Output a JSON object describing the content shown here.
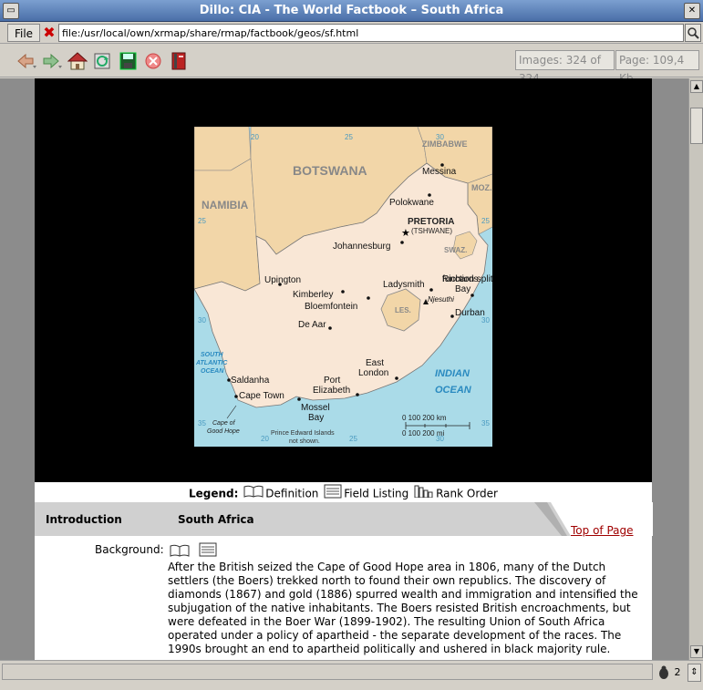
{
  "window": {
    "title": "Dillo: CIA - The World Factbook – South Africa"
  },
  "location": {
    "file_menu": "File",
    "url": "file:/usr/local/own/xrmap/share/rmap/factbook/geos/sf.html"
  },
  "toolbar": {
    "tools": [
      "back-icon",
      "forward-icon",
      "home-icon",
      "reload-icon",
      "save-icon",
      "stop-icon",
      "bookmarks-icon"
    ],
    "images_status": "Images: 324 of 324",
    "page_status": "Page: 109,4 Kb"
  },
  "map": {
    "countries": [
      "BOTSWANA",
      "NAMIBIA",
      "ZIMBABWE",
      "MOZ.",
      "SWAZ.",
      "LES."
    ],
    "capital": "PRETORIA",
    "capital_alt": "(TSHWANE)",
    "cities": [
      "Messina",
      "Polokwane",
      "Johannesburg",
      "Upington",
      "Kimberley",
      "Bloemfontein",
      "Ladysmith",
      "Richards Bay",
      "Njesuthi",
      "Durban",
      "De Aar",
      "Saldanha",
      "Cape Town",
      "Mossel Bay",
      "Port Elizabeth",
      "East London",
      "Cape of Good Hope"
    ],
    "ocean_atlantic": [
      "SOUTH",
      "ATLANTIC",
      "OCEAN"
    ],
    "ocean_indian": [
      "INDIAN",
      "OCEAN"
    ],
    "note": [
      "Prince Edward Islands",
      "not shown."
    ],
    "scale_km": "0    100  200 km",
    "scale_mi": "0       100       200 mi",
    "grid_labels": [
      "20",
      "25",
      "30",
      "25",
      "30",
      "35",
      "20",
      "25",
      "30",
      "35",
      "25",
      "30",
      "35"
    ]
  },
  "legend": {
    "label": "Legend:",
    "definition": "Definition",
    "field_listing": "Field Listing",
    "rank_order": "Rank Order"
  },
  "section": {
    "title": "Introduction",
    "country": "South Africa",
    "top_link": "Top of Page"
  },
  "background": {
    "label": "Background:",
    "text": "After the British seized the Cape of Good Hope area in 1806, many of the Dutch settlers (the Boers) trekked north to found their own republics. The discovery of diamonds (1867) and gold (1886) spurred wealth and immigration and intensified the subjugation of the native inhabitants. The Boers resisted British encroachments, but were defeated in the Boer War (1899-1902). The resulting Union of South Africa operated under a policy of apartheid - the separate development of the races. The 1990s brought an end to apartheid politically and ushered in black majority rule."
  },
  "statusbar": {
    "bug_count": "2"
  }
}
